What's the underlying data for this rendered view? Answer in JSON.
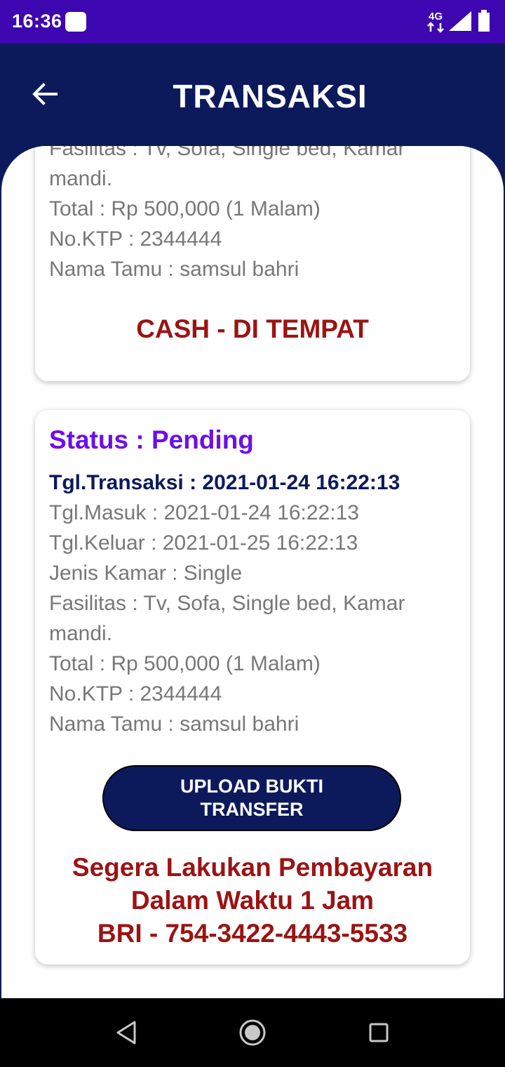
{
  "status_bar": {
    "time": "16:36",
    "network": "4G"
  },
  "app_bar": {
    "title": "TRANSAKSI"
  },
  "transactions": [
    {
      "fasilitas": "Fasilitas : Tv, Sofa, Single bed, Kamar",
      "fasilitas_cont": "mandi.",
      "total": "Total : Rp 500,000 (1 Malam)",
      "ktp": "No.KTP : 2344444",
      "nama": "Nama Tamu : samsul bahri",
      "payment_method": "CASH - DI TEMPAT"
    },
    {
      "status": "Status : Pending",
      "tgl_transaksi": "Tgl.Transaksi : 2021-01-24 16:22:13",
      "tgl_masuk": "Tgl.Masuk : 2021-01-24 16:22:13",
      "tgl_keluar": "Tgl.Keluar : 2021-01-25 16:22:13",
      "jenis_kamar": "Jenis Kamar : Single",
      "fasilitas": "Fasilitas : Tv, Sofa, Single bed, Kamar",
      "fasilitas_cont": "mandi.",
      "total": "Total : Rp 500,000 (1 Malam)",
      "ktp": "No.KTP : 2344444",
      "nama": "Nama Tamu : samsul bahri",
      "upload_button": "UPLOAD BUKTI TRANSFER",
      "payment_line1": "Segera Lakukan Pembayaran",
      "payment_line2": "Dalam Waktu 1 Jam",
      "payment_line3": "BRI - 754-3422-4443-5533"
    }
  ],
  "colors": {
    "status_bar": "#3d06b0",
    "primary": "#0c1a5c",
    "status_pending": "#6c0fe8",
    "alert_red": "#9b1313",
    "body_text": "#777777"
  },
  "icons": {
    "back": "back-arrow-icon",
    "nav_back": "nav-back-icon",
    "nav_home": "nav-home-icon",
    "nav_recents": "nav-recents-icon"
  }
}
